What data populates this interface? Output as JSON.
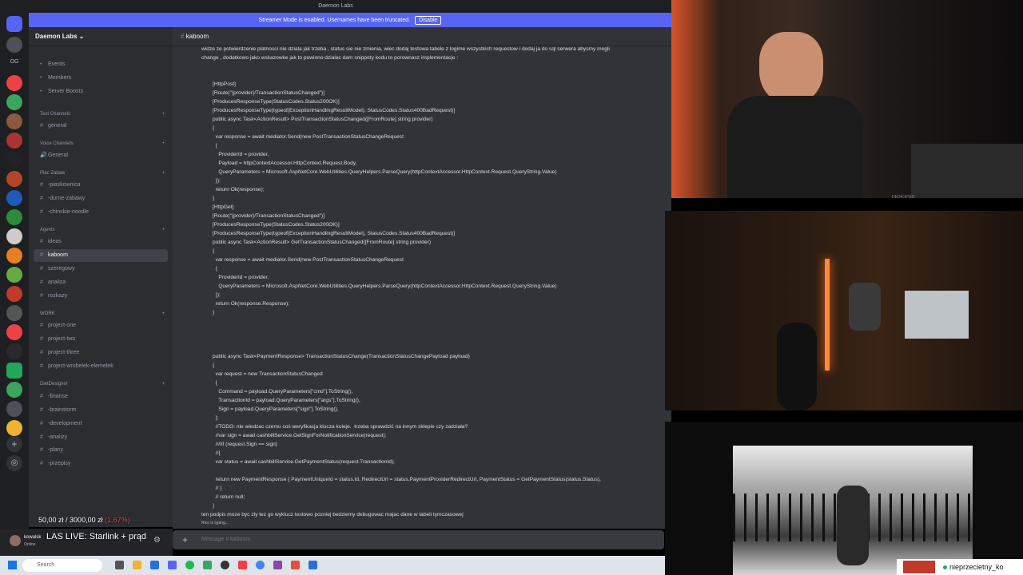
{
  "window": {
    "title": "Daemon Labs"
  },
  "banner": {
    "text": "Streamer Mode is enabled. Usernames have been truncated.",
    "button": "Disable"
  },
  "rail": {
    "label": "OG"
  },
  "server": {
    "name": "Daemon Labs"
  },
  "sidebar": {
    "items": [
      {
        "kind": "link",
        "icon": "calendar-icon",
        "label": "Events"
      },
      {
        "kind": "link",
        "icon": "members-icon",
        "label": "Members"
      },
      {
        "kind": "link",
        "icon": "boost-icon",
        "label": "Server Boosts"
      },
      {
        "kind": "cat",
        "label": "Text Channels"
      },
      {
        "kind": "chan",
        "icon": "#",
        "label": "general"
      },
      {
        "kind": "cat",
        "label": "Voice Channels"
      },
      {
        "kind": "chan",
        "icon": "voice",
        "label": "General"
      },
      {
        "kind": "cat",
        "label": "Plac Zabaw"
      },
      {
        "kind": "chan",
        "icon": "#",
        "label": "-piaskownica"
      },
      {
        "kind": "chan",
        "icon": "#",
        "label": "-durne-zabawy"
      },
      {
        "kind": "chan",
        "icon": "#",
        "label": "-chinskie-noodle"
      },
      {
        "kind": "cat",
        "label": "Agents"
      },
      {
        "kind": "chan",
        "icon": "#",
        "label": "ideas"
      },
      {
        "kind": "chan",
        "icon": "#",
        "label": "kaboom",
        "active": true
      },
      {
        "kind": "chan",
        "icon": "#",
        "label": "szeregowy"
      },
      {
        "kind": "chan",
        "icon": "#",
        "label": "analiza"
      },
      {
        "kind": "chan",
        "icon": "#",
        "label": "rozkazy"
      },
      {
        "kind": "cat",
        "label": "WORK"
      },
      {
        "kind": "chan",
        "icon": "#",
        "label": "project-one"
      },
      {
        "kind": "chan",
        "icon": "#",
        "label": "project-two"
      },
      {
        "kind": "chan",
        "icon": "#",
        "label": "project-three"
      },
      {
        "kind": "chan",
        "icon": "#",
        "label": "project-wrobelek-elemelek"
      },
      {
        "kind": "cat",
        "label": "DietDesigner"
      },
      {
        "kind": "chan",
        "icon": "#",
        "label": "-finanse"
      },
      {
        "kind": "chan",
        "icon": "#",
        "label": "-brainstorm"
      },
      {
        "kind": "chan",
        "icon": "#",
        "label": "-development"
      },
      {
        "kind": "chan",
        "icon": "#",
        "label": "-analizy"
      },
      {
        "kind": "chan",
        "icon": "#",
        "label": "-plany"
      },
      {
        "kind": "chan",
        "icon": "#",
        "label": "-przepisy"
      }
    ]
  },
  "chat": {
    "channel": "kaboom",
    "intro_line1": "widze  ze potwierdzenie platnosci nie dziala jak trzeba , status sie nie zmienia, wiec dodaj testowa tabele z logime wszystkich requestow i dodaj ja do sql serwera  abysmy mogli",
    "intro_line2": "change , dodatkowo jako wskazowke jak to powinno dzialac dam snippety kodu to porownasz implementacje :",
    "code": "[HttpPost]\n[Route(\"{provider}/TransactionStatusChanged\")]\n[ProducesResponseType(StatusCodes.Status200OK)]\n[ProducesResponseType(typeof(ExceptionHandlingResultModel), StatusCodes.Status400BadRequest)]\npublic async Task<ActionResult> PostTransactionStatusChanged([FromRoute] string provider)\n{\n  var response = await mediator.Send(new PostTransactionStatusChangeRequest\n  {\n    ProviderId = provider,\n    Payload = httpContextAccessor.HttpContext.Request.Body,\n    QueryParameters = Microsoft.AspNetCore.WebUtilities.QueryHelpers.ParseQuery(httpContextAccessor.HttpContext.Request.QueryString.Value)\n  });\n  return Ok(response);\n}\n[HttpGet]\n[Route(\"{provider}/TransactionStatusChanged\")]\n[ProducesResponseType(StatusCodes.Status200OK)]\n[ProducesResponseType(typeof(ExceptionHandlingResultModel), StatusCodes.Status400BadRequest)]\npublic async Task<ActionResult> GetTransactionStatusChanged([FromRoute] string provider)\n{\n  var response = await mediator.Send(new PostTransactionStatusChangeRequest\n  {\n    ProviderId = provider,\n    QueryParameters = Microsoft.AspNetCore.WebUtilities.QueryHelpers.ParseQuery(httpContextAccessor.HttpContext.Request.QueryString.Value)\n  });\n  return Ok(response.Response);\n}\n\n\n\n\npublic async Task<PaymentResponse> TransactionStatusChange(TransactionStatusChangePayload payload)\n{\n  var request = new TransactionStatusChanged\n  {\n    Command = payload.QueryParameters[\"cmd\"].ToString(),\n    TransactionId = payload.QueryParameters[\"args\"].ToString(),\n    Sign = payload.QueryParameters[\"sign\"].ToString(),\n  };\n  //TODO: nie wiedzac czemu coś weryfikacja klucza kuleje.  trzeba sprawdzić na innym sklepie czy zadziała?\n  //var sign = await cashbillService.GetSignForNotificationService(request);\n  ////if (request.Sign == sign)\n  //{\n  var status = await cashbillService.GetPaymentStatus(request.TransactionId);\n\n  return new PaymentResponse { PaymentUniqueId = status.Id, RedirectUrl = status.PaymentProviderRedirectUrl, PaymentStatus = GetPaymentStatus(status.Status),\n  // }\n  // return null;\n}",
    "outro": "ten podpis moze byc zly tez go wyklucz testowo pozniej bedziemy debugowac majac dane w tabeli tymczasowej",
    "typing": "Rico is typing...",
    "composer_placeholder": "Message # kaboom"
  },
  "overlay": {
    "money_current": "50,00 zł",
    "money_goal": "3000,00 zł",
    "money_pct": "(1.67%)",
    "live_title": "LAS LIVE: Starlink + prąd"
  },
  "user": {
    "name": "kowalsk",
    "status": "Online"
  },
  "taskbar": {
    "search": "Search"
  },
  "cams": {
    "nick": "nieprzecietny_ko",
    "caption": "DEDICATED"
  },
  "colors": {
    "accent": "#5865f2",
    "online": "#23a55a"
  }
}
